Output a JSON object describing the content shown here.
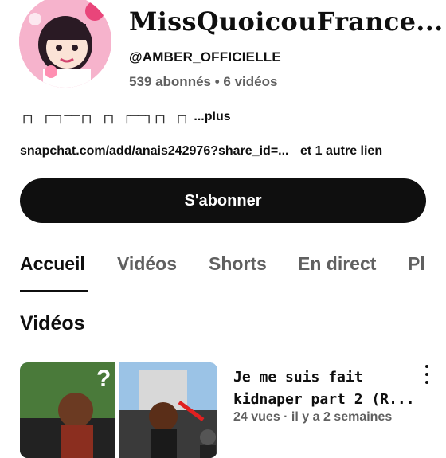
{
  "channel": {
    "name": "MissQuoicouFrance...",
    "handle": "@AMBER_OFFICIELLE",
    "stats": "539 abonnés • 6 vidéos",
    "description_glyphs": "┌┐ ┌─┐──┌┐ ┌┐ ┌──┐┌┐ ┌┐",
    "more_label": "...plus",
    "link": "snapchat.com/add/anais242976?share_id=...",
    "extra_links": "et 1 autre lien"
  },
  "subscribe_label": "S'abonner",
  "tabs": [
    {
      "label": "Accueil"
    },
    {
      "label": "Vidéos"
    },
    {
      "label": "Shorts"
    },
    {
      "label": "En direct"
    },
    {
      "label": "Pl"
    }
  ],
  "section_title": "Vidéos",
  "video": {
    "title": "Je me suis fait kidnaper part 2 (R...",
    "meta": "24 vues · il y a 2 semaines"
  },
  "icons": {
    "avatar": "avatar-image",
    "menu": "more-vert-icon"
  }
}
